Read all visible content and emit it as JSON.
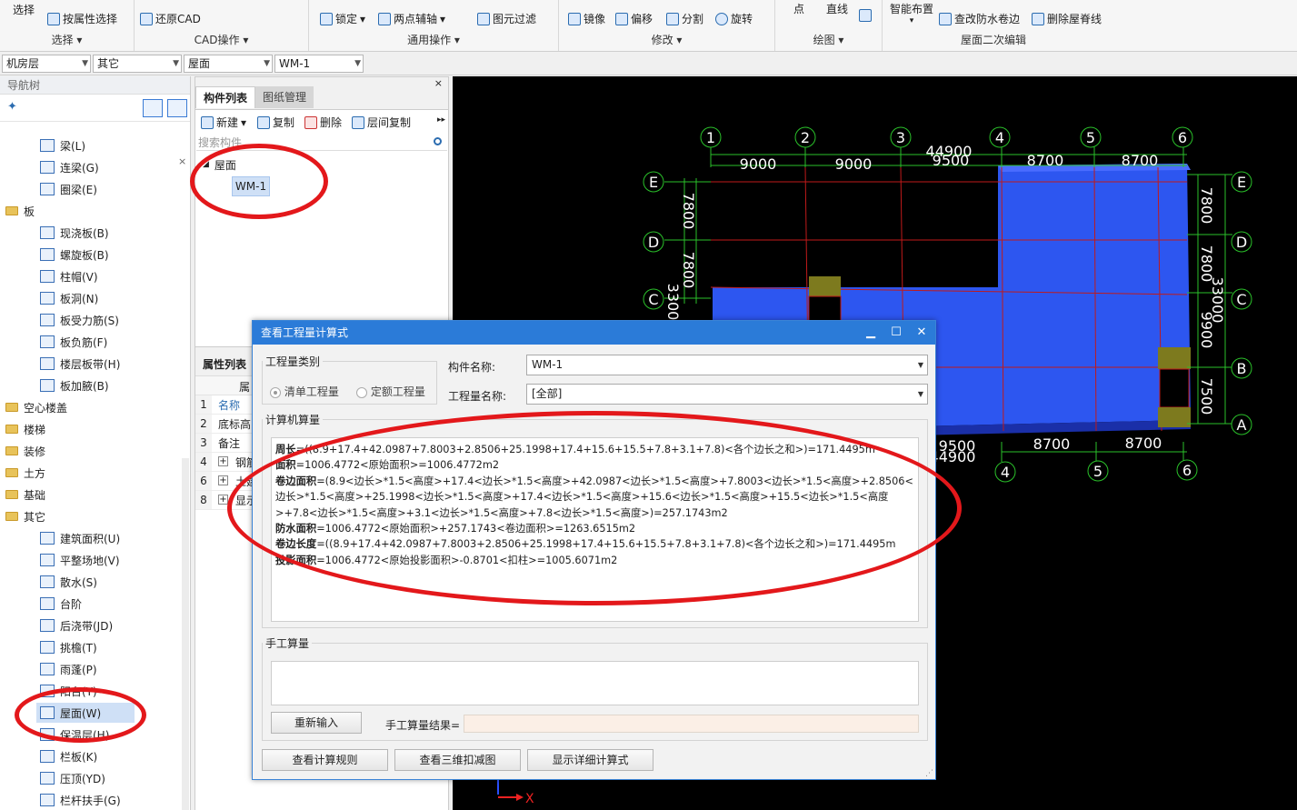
{
  "ribbon": {
    "select_btn": "选择",
    "by_attr": "按属性选择",
    "restore_cad": "还原CAD",
    "lock": "锁定",
    "two_point_axis": "两点辅轴",
    "element_filter": "图元过滤",
    "mirror": "镜像",
    "offset": "偏移",
    "split": "分割",
    "rotate": "旋转",
    "point": "点",
    "line": "直线",
    "smart_layout": "智能布置",
    "modify_waterproof": "查改防水卷边",
    "delete_ridge": "删除屋脊线",
    "groups": [
      "选择",
      "CAD操作",
      "通用操作",
      "修改",
      "绘图",
      "屋面二次编辑"
    ]
  },
  "selectors": [
    "机房层",
    "其它",
    "屋面",
    "WM-1"
  ],
  "nav": {
    "title": "导航树",
    "items": [
      {
        "label": "梁(L)",
        "level": 1
      },
      {
        "label": "连梁(G)",
        "level": 1
      },
      {
        "label": "圈梁(E)",
        "level": 1
      },
      {
        "label": "板",
        "level": 0
      },
      {
        "label": "现浇板(B)",
        "level": 1
      },
      {
        "label": "螺旋板(B)",
        "level": 1
      },
      {
        "label": "柱帽(V)",
        "level": 1
      },
      {
        "label": "板洞(N)",
        "level": 1
      },
      {
        "label": "板受力筋(S)",
        "level": 1
      },
      {
        "label": "板负筋(F)",
        "level": 1
      },
      {
        "label": "楼层板带(H)",
        "level": 1
      },
      {
        "label": "板加腋(B)",
        "level": 1
      },
      {
        "label": "空心楼盖",
        "level": 0
      },
      {
        "label": "楼梯",
        "level": 0
      },
      {
        "label": "装修",
        "level": 0
      },
      {
        "label": "土方",
        "level": 0
      },
      {
        "label": "基础",
        "level": 0
      },
      {
        "label": "其它",
        "level": 0
      },
      {
        "label": "建筑面积(U)",
        "level": 1
      },
      {
        "label": "平整场地(V)",
        "level": 1
      },
      {
        "label": "散水(S)",
        "level": 1
      },
      {
        "label": "台阶",
        "level": 1
      },
      {
        "label": "后浇带(JD)",
        "level": 1
      },
      {
        "label": "挑檐(T)",
        "level": 1
      },
      {
        "label": "雨蓬(P)",
        "level": 1
      },
      {
        "label": "阳台(Y)",
        "level": 1
      },
      {
        "label": "屋面(W)",
        "level": 1
      },
      {
        "label": "保温层(H)",
        "level": 1
      },
      {
        "label": "栏板(K)",
        "level": 1
      },
      {
        "label": "压顶(YD)",
        "level": 1
      },
      {
        "label": "栏杆扶手(G)",
        "level": 1
      }
    ]
  },
  "components": {
    "tab_list": "构件列表",
    "tab_drawing": "图纸管理",
    "new": "新建",
    "copy": "复制",
    "delete": "删除",
    "floor_copy": "层间复制",
    "search_placeholder": "搜索构件...",
    "tree_root": "屋面",
    "tree_child": "WM-1",
    "props_title": "属性列表",
    "props_col": "属",
    "props": [
      {
        "n": "1",
        "name": "名称"
      },
      {
        "n": "2",
        "name": "底标高"
      },
      {
        "n": "3",
        "name": "备注"
      },
      {
        "n": "4",
        "name": "钢筋"
      },
      {
        "n": "6",
        "name": "土建"
      },
      {
        "n": "8",
        "name": "显示"
      }
    ]
  },
  "cad": {
    "axes_top": [
      "1",
      "2",
      "3",
      "4",
      "5",
      "6"
    ],
    "axes_side": [
      "E",
      "D",
      "C",
      "B",
      "A"
    ],
    "dim_top_total": "44900",
    "dim_top": [
      "9000",
      "9000",
      "9500",
      "8700",
      "8700"
    ],
    "dim_bottom": [
      "9500",
      "8700",
      "8700"
    ],
    "dim_bottom_total": "44900",
    "dim_left": [
      "7800",
      "7800",
      "3300"
    ],
    "dim_right": [
      "7800",
      "7800",
      "9900",
      "7500"
    ],
    "dim_right_total": "33000",
    "axis_x_label": "X"
  },
  "dialog": {
    "title": "查看工程量计算式",
    "qty_type_legend": "工程量类别",
    "opt_list": "清单工程量",
    "opt_quota": "定额工程量",
    "comp_name_label": "构件名称:",
    "comp_name_value": "WM-1",
    "qty_name_label": "工程量名称:",
    "qty_name_value": "[全部]",
    "calc_legend": "计算机算量",
    "calc_lines": [
      {
        "label": "周长",
        "text": "=((8.9+17.4+42.0987+7.8003+2.8506+25.1998+17.4+15.6+15.5+7.8+3.1+7.8)<各个边长之和>)=171.4495m"
      },
      {
        "label": "面积",
        "text": "=1006.4772<原始面积>=1006.4772m2"
      },
      {
        "label": "卷边面积",
        "text": "=(8.9<边长>*1.5<高度>+17.4<边长>*1.5<高度>+42.0987<边长>*1.5<高度>+7.8003<边长>*1.5<高度>+2.8506<边长>*1.5<高度>+25.1998<边长>*1.5<高度>+17.4<边长>*1.5<高度>+15.6<边长>*1.5<高度>+15.5<边长>*1.5<高度>+7.8<边长>*1.5<高度>+3.1<边长>*1.5<高度>+7.8<边长>*1.5<高度>)=257.1743m2"
      },
      {
        "label": "防水面积",
        "text": "=1006.4772<原始面积>+257.1743<卷边面积>=1263.6515m2"
      },
      {
        "label": "卷边长度",
        "text": "=((8.9+17.4+42.0987+7.8003+2.8506+25.1998+17.4+15.6+15.5+7.8+3.1+7.8)<各个边长之和>)=171.4495m"
      },
      {
        "label": "投影面积",
        "text": "=1006.4772<原始投影面积>-0.8701<扣柱>=1005.6071m2"
      }
    ],
    "manual_legend": "手工算量",
    "reinput": "重新输入",
    "manual_result_label": "手工算量结果=",
    "btn_rules": "查看计算规则",
    "btn_3d": "查看三维扣减图",
    "btn_detail": "显示详细计算式"
  }
}
